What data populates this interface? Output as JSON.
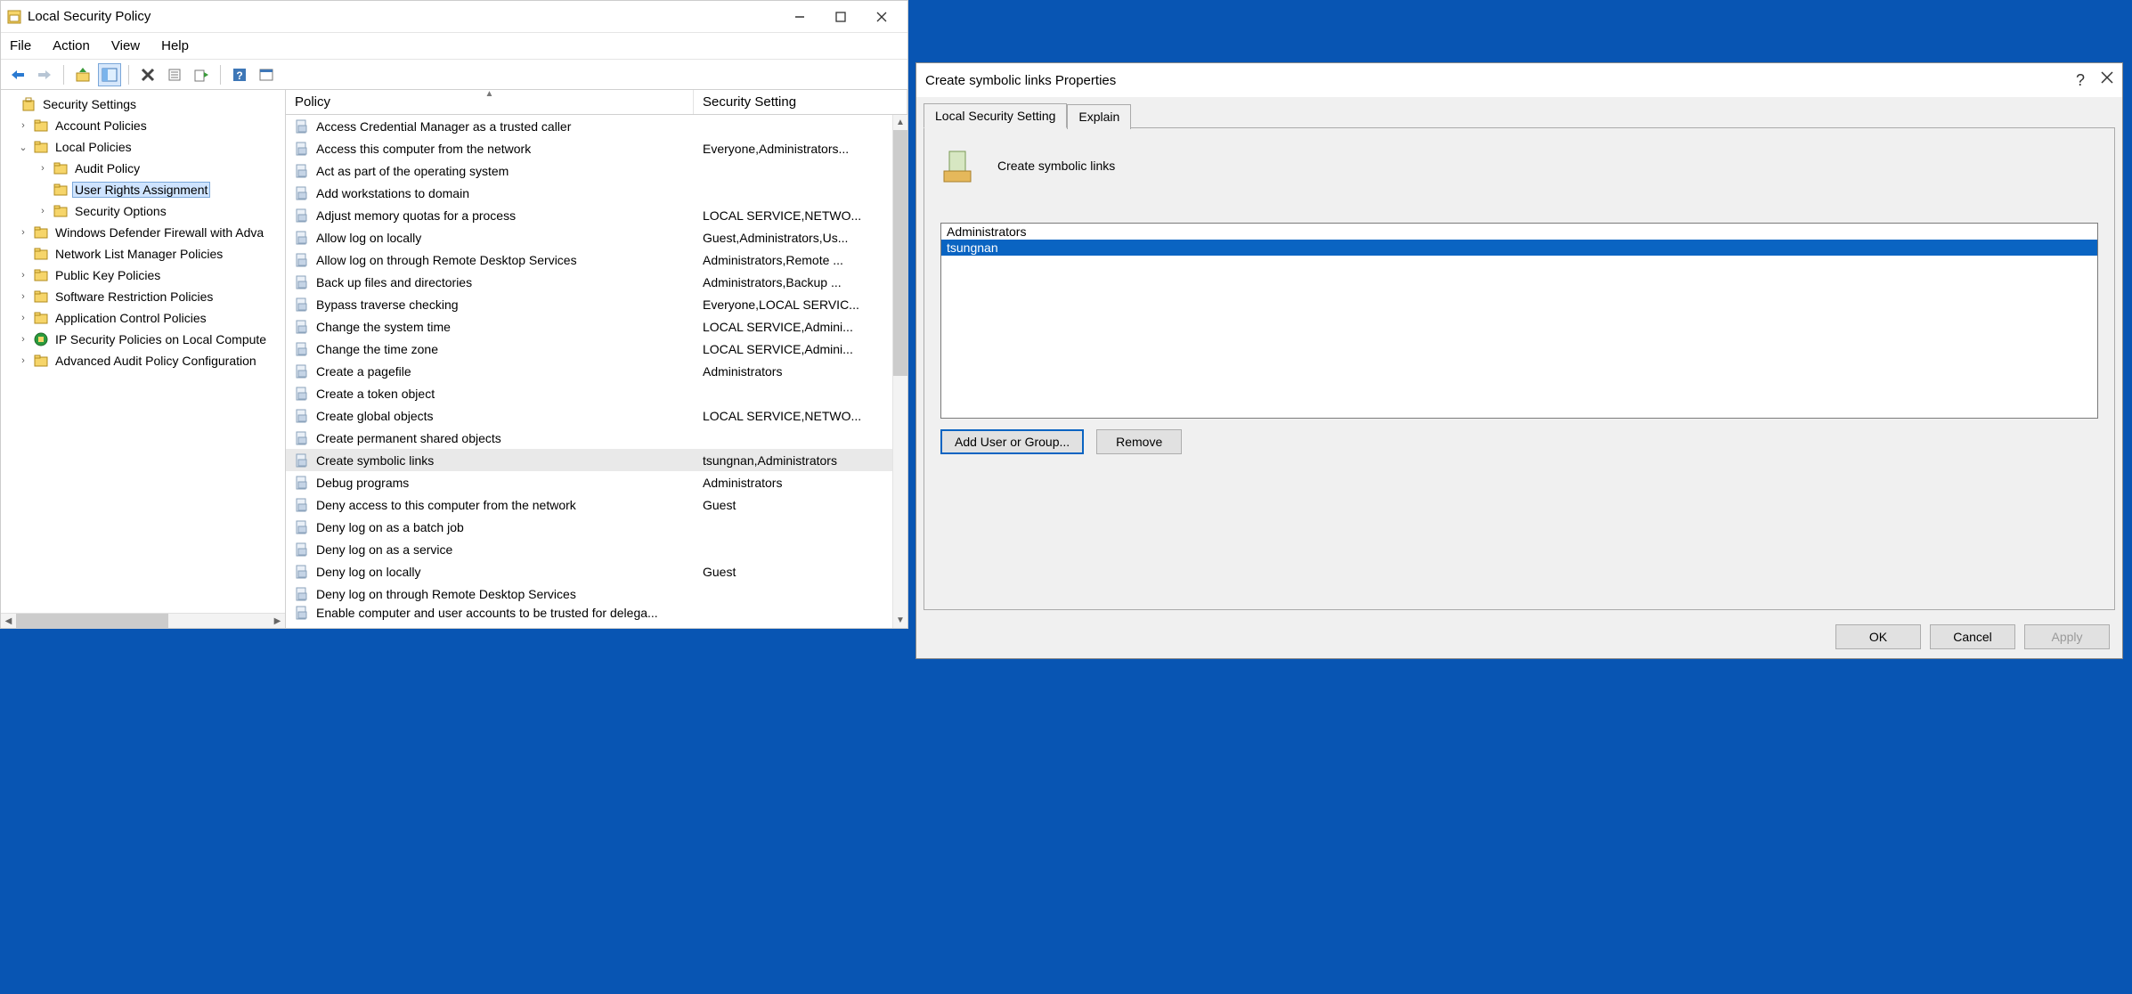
{
  "window": {
    "title": "Local Security Policy"
  },
  "menu": {
    "file": "File",
    "action": "Action",
    "view": "View",
    "help": "Help"
  },
  "tree": {
    "root": "Security Settings",
    "items": [
      {
        "label": "Account Policies",
        "indent": 1,
        "exp": "›"
      },
      {
        "label": "Local Policies",
        "indent": 1,
        "exp": "⌄"
      },
      {
        "label": "Audit Policy",
        "indent": 2,
        "exp": "›"
      },
      {
        "label": "User Rights Assignment",
        "indent": 2,
        "exp": "",
        "selected": true
      },
      {
        "label": "Security Options",
        "indent": 2,
        "exp": "›"
      },
      {
        "label": "Windows Defender Firewall with Adva",
        "indent": 1,
        "exp": "›"
      },
      {
        "label": "Network List Manager Policies",
        "indent": 1,
        "exp": ""
      },
      {
        "label": "Public Key Policies",
        "indent": 1,
        "exp": "›"
      },
      {
        "label": "Software Restriction Policies",
        "indent": 1,
        "exp": "›"
      },
      {
        "label": "Application Control Policies",
        "indent": 1,
        "exp": "›"
      },
      {
        "label": "IP Security Policies on Local Compute",
        "indent": 1,
        "exp": "›",
        "ip": true
      },
      {
        "label": "Advanced Audit Policy Configuration",
        "indent": 1,
        "exp": "›"
      }
    ]
  },
  "columns": {
    "policy": "Policy",
    "setting": "Security Setting"
  },
  "policies": [
    {
      "name": "Access Credential Manager as a trusted caller",
      "setting": ""
    },
    {
      "name": "Access this computer from the network",
      "setting": "Everyone,Administrators..."
    },
    {
      "name": "Act as part of the operating system",
      "setting": ""
    },
    {
      "name": "Add workstations to domain",
      "setting": ""
    },
    {
      "name": "Adjust memory quotas for a process",
      "setting": "LOCAL SERVICE,NETWO..."
    },
    {
      "name": "Allow log on locally",
      "setting": "Guest,Administrators,Us..."
    },
    {
      "name": "Allow log on through Remote Desktop Services",
      "setting": "Administrators,Remote ..."
    },
    {
      "name": "Back up files and directories",
      "setting": "Administrators,Backup ..."
    },
    {
      "name": "Bypass traverse checking",
      "setting": "Everyone,LOCAL SERVIC..."
    },
    {
      "name": "Change the system time",
      "setting": "LOCAL SERVICE,Admini..."
    },
    {
      "name": "Change the time zone",
      "setting": "LOCAL SERVICE,Admini..."
    },
    {
      "name": "Create a pagefile",
      "setting": "Administrators"
    },
    {
      "name": "Create a token object",
      "setting": ""
    },
    {
      "name": "Create global objects",
      "setting": "LOCAL SERVICE,NETWO..."
    },
    {
      "name": "Create permanent shared objects",
      "setting": ""
    },
    {
      "name": "Create symbolic links",
      "setting": "tsungnan,Administrators",
      "selected": true
    },
    {
      "name": "Debug programs",
      "setting": "Administrators"
    },
    {
      "name": "Deny access to this computer from the network",
      "setting": "Guest"
    },
    {
      "name": "Deny log on as a batch job",
      "setting": ""
    },
    {
      "name": "Deny log on as a service",
      "setting": ""
    },
    {
      "name": "Deny log on locally",
      "setting": "Guest"
    },
    {
      "name": "Deny log on through Remote Desktop Services",
      "setting": ""
    },
    {
      "name": "Enable computer and user accounts to be trusted for delega...",
      "setting": "",
      "cutoff": true
    }
  ],
  "dialog": {
    "title": "Create symbolic links Properties",
    "tab_local": "Local Security Setting",
    "tab_explain": "Explain",
    "policy_name": "Create symbolic links",
    "members": [
      {
        "name": "Administrators",
        "selected": false
      },
      {
        "name": "tsungnan",
        "selected": true
      }
    ],
    "add": "Add User or Group...",
    "remove": "Remove",
    "ok": "OK",
    "cancel": "Cancel",
    "apply": "Apply"
  }
}
